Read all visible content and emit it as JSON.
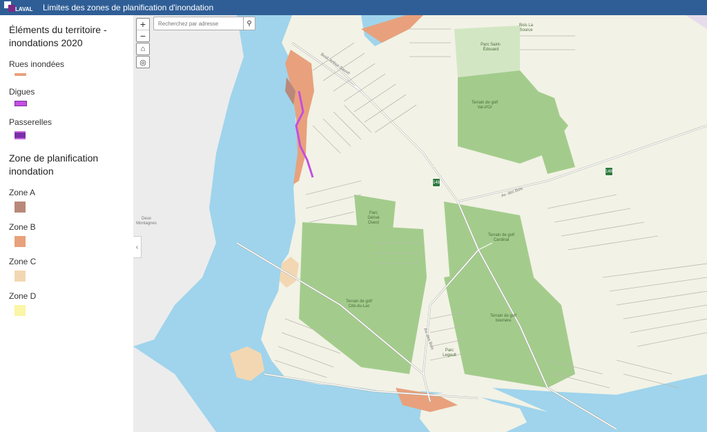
{
  "header": {
    "logo_text": "LAVAL",
    "title": "Limites des zones de planification d'inondation"
  },
  "legend": {
    "section1_title": "Éléments du territoire - inondations 2020",
    "items1": [
      {
        "label": "Rues inondées",
        "color": "#e8a17c"
      },
      {
        "label": "Digues",
        "color": "#c44fe0"
      },
      {
        "label": "Passerelles",
        "color": "#7b2fa6"
      }
    ],
    "section2_title": "Zone de planification inondation",
    "zones": [
      {
        "label": "Zone A",
        "color": "#b9887a"
      },
      {
        "label": "Zone B",
        "color": "#e8a17c"
      },
      {
        "label": "Zone C",
        "color": "#f3d7b2"
      },
      {
        "label": "Zone D",
        "color": "#fbf5a7"
      }
    ]
  },
  "map_controls": {
    "zoom_in": "+",
    "zoom_out": "−",
    "home_icon": "home-icon",
    "locate_icon": "locate-icon",
    "search_placeholder": "Recherchez par adresse",
    "search_icon": "search-icon",
    "collapse_icon": "chevron-left-icon"
  },
  "map_labels": {
    "bois": "Bois La Source",
    "parc_edouard": "Parc Saint-Édouard",
    "golf1": "Terrain de golf Val-d'Or",
    "golf_carnival": "Terrain de golf Cardinal",
    "golf_lac": "Terrain de golf Cité-du-Lac",
    "golf_islemere": "Terrain de golf Islemère",
    "parc_ouest": "Parc Dérivé Ouest",
    "parc_lakebeach": "Parc Legault",
    "deux_montagnes": "Deux Montagnes",
    "road1": "Av. des Bois",
    "road2": "Av. des Bois",
    "road3": "Boul. Arthur-Sauvé",
    "shield1": "148",
    "shield2": "148"
  },
  "colors": {
    "water": "#9fd4ec",
    "green": "#a3cc8c",
    "land": "#f2f2e6",
    "road": "#ffffff",
    "road_outline": "#a8a8a0",
    "west_land": "#ececec"
  }
}
